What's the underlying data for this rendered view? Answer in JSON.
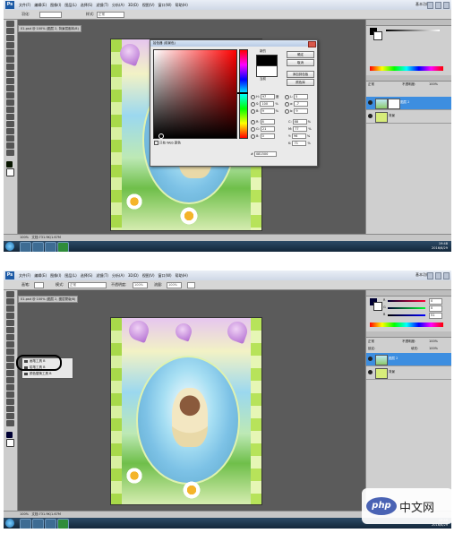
{
  "top": {
    "app_icon": "Ps",
    "menus": [
      "文件(F)",
      "编辑(E)",
      "图像(I)",
      "图层(L)",
      "选择(S)",
      "滤镜(T)",
      "分析(A)",
      "3D(D)",
      "视图(V)",
      "窗口(W)",
      "帮助(H)"
    ],
    "workspace_label": "基本功能",
    "options": {
      "feather_label": "羽化:",
      "style_label": "样式:",
      "style_value": "正常"
    },
    "doc_tab": "01.psd @ 100% (图层 2, 背景层副本/8)",
    "status": {
      "zoom": "100%",
      "doc_size": "文档:731.9K/1.67M"
    },
    "color_picker": {
      "title": "拾色器 (前景色)",
      "new_label": "新的",
      "current_label": "当前",
      "buttons": [
        "确定",
        "取消",
        "添加到色板",
        "颜色库"
      ],
      "hsb": [
        {
          "label": "H:",
          "value": "97",
          "unit": "度"
        },
        {
          "label": "S:",
          "value": "100",
          "unit": "%"
        },
        {
          "label": "B:",
          "value": "9",
          "unit": "%"
        }
      ],
      "rgb": [
        {
          "label": "R:",
          "value": "8"
        },
        {
          "label": "G:",
          "value": "21"
        },
        {
          "label": "B:",
          "value": "0"
        }
      ],
      "lab": [
        {
          "label": "L:",
          "value": "5"
        },
        {
          "label": "a:",
          "value": "-7"
        },
        {
          "label": "b:",
          "value": "9"
        }
      ],
      "cmyk": [
        {
          "label": "C:",
          "value": "88",
          "unit": "%"
        },
        {
          "label": "M:",
          "value": "77",
          "unit": "%"
        },
        {
          "label": "Y:",
          "value": "96",
          "unit": "%"
        },
        {
          "label": "K:",
          "value": "71",
          "unit": "%"
        }
      ],
      "web_only": "只有 Web 颜色",
      "hex_label": "#",
      "hex_value": "081500"
    },
    "layers": {
      "mode": "正常",
      "opacity_label": "不透明度:",
      "opacity": "100%",
      "rows": [
        {
          "name": "图层 2"
        },
        {
          "name": "背景"
        }
      ]
    },
    "clock": {
      "time": "19:48",
      "date": "2016/6/29"
    }
  },
  "bottom": {
    "app_icon": "Ps",
    "menus": [
      "文件(F)",
      "编辑(E)",
      "图像(I)",
      "图层(L)",
      "选择(S)",
      "滤镜(T)",
      "分析(A)",
      "3D(D)",
      "视图(V)",
      "窗口(W)",
      "帮助(H)"
    ],
    "workspace_label": "基本功能",
    "options": {
      "brush_label": "画笔:",
      "mode_label": "模式:",
      "mode_value": "正常",
      "opacity_label": "不透明度:",
      "opacity": "100%",
      "flow_label": "流量:",
      "flow": "100%"
    },
    "doc_tab": "01.psd @ 100% (图层 2, 图层蒙版/8)",
    "flyout": [
      "画笔工具",
      "铅笔工具",
      "颜色替换工具"
    ],
    "flyout_keys": [
      "B",
      "B",
      "B"
    ],
    "color_panel": {
      "r": "0",
      "g": "0",
      "b": "51"
    },
    "layers": {
      "mode": "正常",
      "opacity_label": "不透明度:",
      "opacity": "100%",
      "lock_label": "锁定:",
      "fill_label": "填充:",
      "fill": "100%",
      "rows": [
        {
          "name": "图层 2"
        },
        {
          "name": "背景"
        }
      ]
    },
    "status": {
      "zoom": "100%",
      "doc_size": "文档:731.9K/1.67M"
    },
    "clock": {
      "time": "19:49",
      "date": "2016/6/29"
    }
  },
  "watermark": {
    "icon": "php",
    "text": "中文网"
  }
}
